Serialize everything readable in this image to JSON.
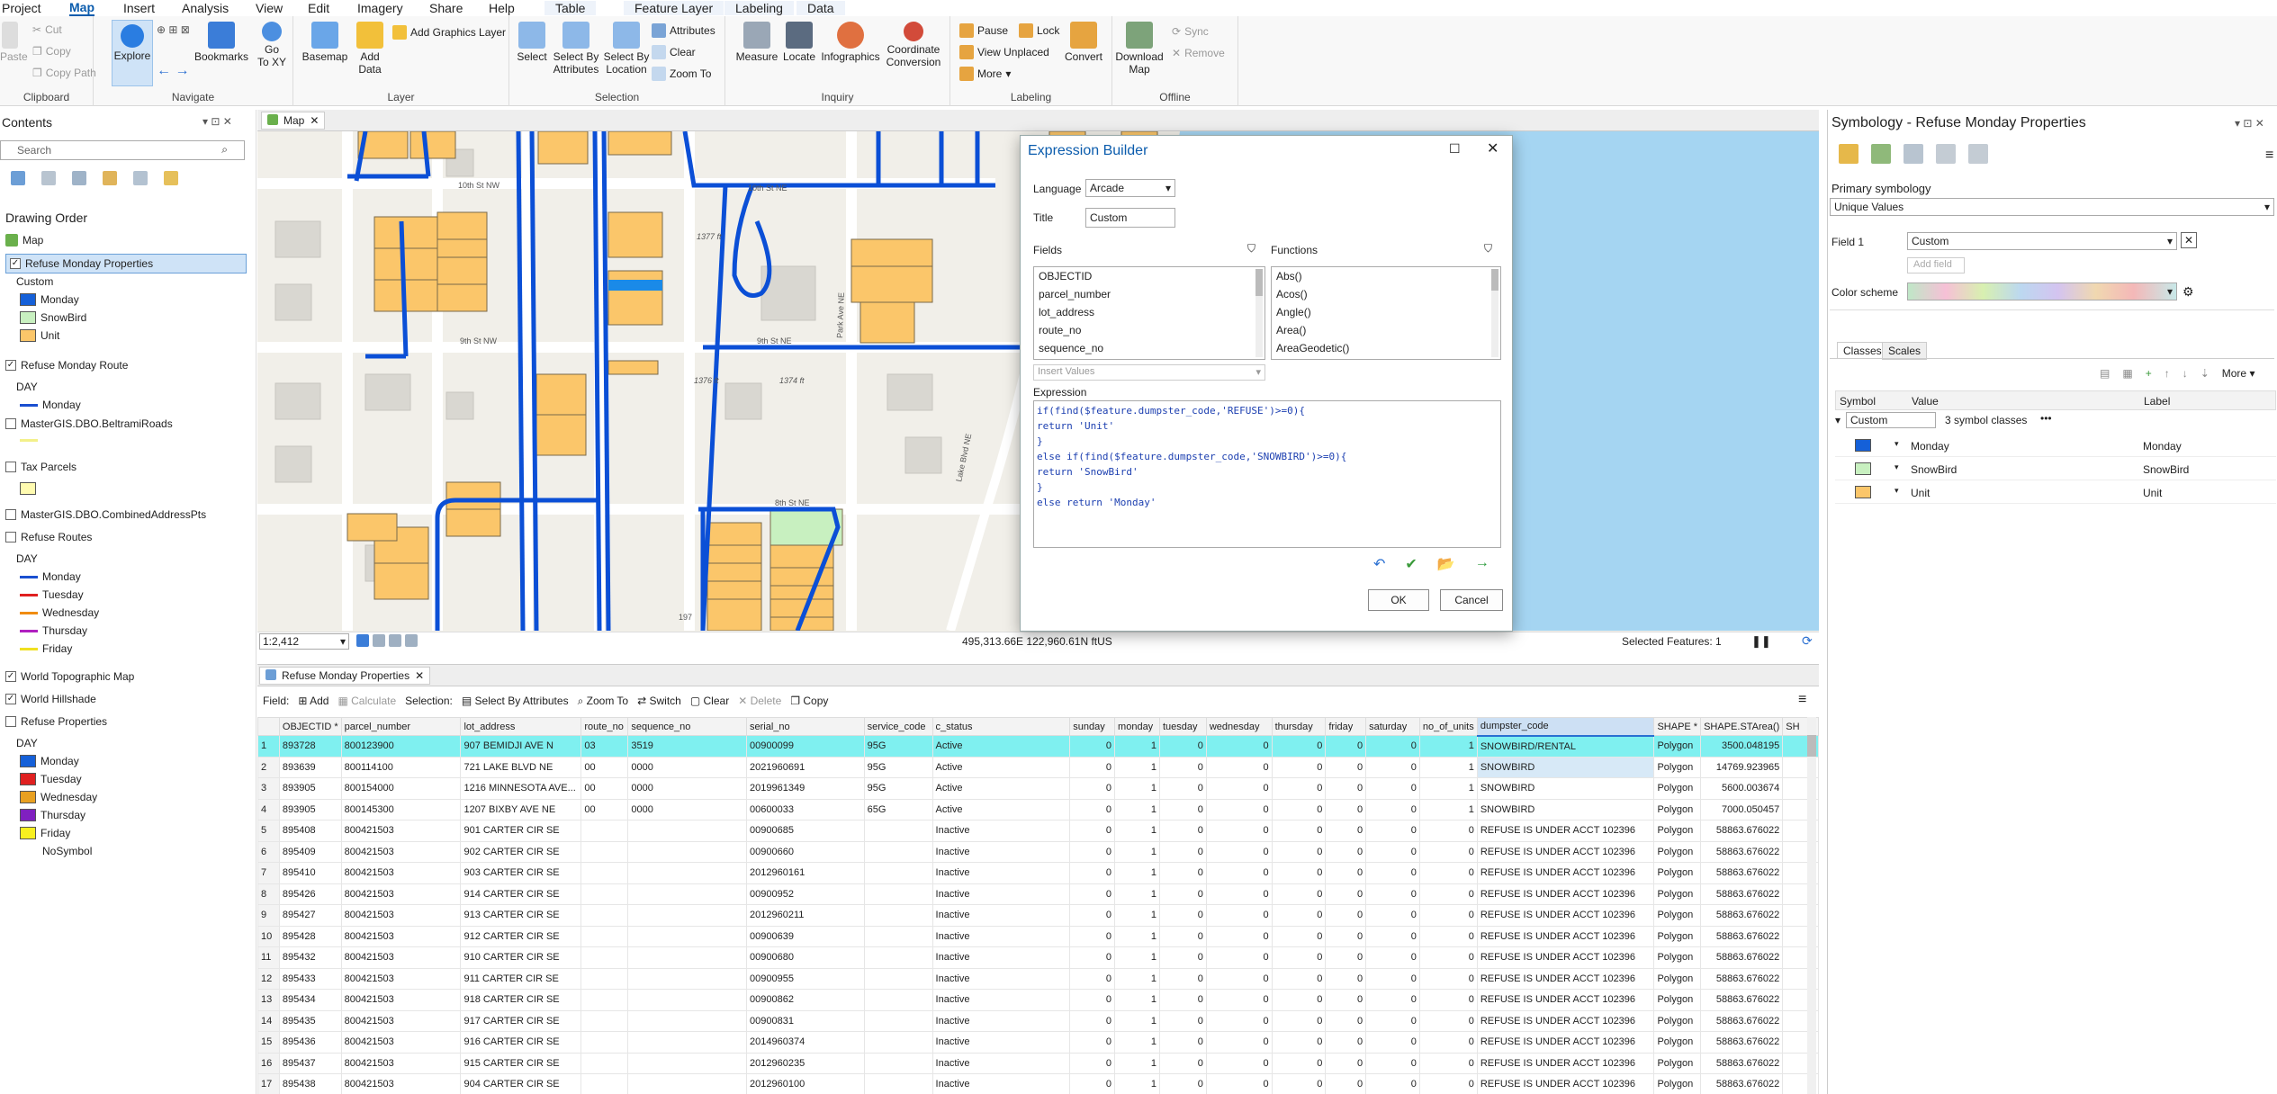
{
  "menu_tabs": [
    "Project",
    "Map",
    "Insert",
    "Analysis",
    "View",
    "Edit",
    "Imagery",
    "Share",
    "Help",
    "Table",
    "Feature Layer",
    "Labeling",
    "Data"
  ],
  "ribbon": {
    "clipboard": {
      "label": "Clipboard",
      "paste": "Paste",
      "cut": "Cut",
      "copy": "Copy",
      "copy_path": "Copy Path"
    },
    "navigate": {
      "label": "Navigate",
      "explore": "Explore",
      "bookmarks": "Bookmarks",
      "goto": "Go\nTo XY"
    },
    "layer": {
      "label": "Layer",
      "basemap": "Basemap",
      "add_data": "Add\nData",
      "add_graphics": "Add Graphics Layer"
    },
    "selection": {
      "label": "Selection",
      "select": "Select",
      "by_attr": "Select By\nAttributes",
      "by_loc": "Select By\nLocation",
      "attributes": "Attributes",
      "clear": "Clear",
      "zoom_to": "Zoom To"
    },
    "inquiry": {
      "label": "Inquiry",
      "measure": "Measure",
      "locate": "Locate",
      "infographics": "Infographics",
      "coord": "Coordinate\nConversion"
    },
    "labeling": {
      "label": "Labeling",
      "pause": "Pause",
      "lock": "Lock",
      "view_unplaced": "View Unplaced",
      "more": "More",
      "convert": "Convert"
    },
    "offline": {
      "label": "Offline",
      "download": "Download\nMap",
      "sync": "Sync",
      "remove": "Remove"
    }
  },
  "contents": {
    "title": "Contents",
    "search_placeholder": "Search",
    "drawing_order": "Drawing Order",
    "map": "Map",
    "layers": [
      {
        "name": "Refuse Monday Properties",
        "checked": true,
        "selected": true,
        "heading": "Custom",
        "legend": [
          {
            "label": "Monday",
            "color": "#1560d8",
            "kind": "swatch"
          },
          {
            "label": "SnowBird",
            "color": "#c8f0c0",
            "kind": "swatch"
          },
          {
            "label": "Unit",
            "color": "#fbc66a",
            "kind": "swatch"
          }
        ]
      },
      {
        "name": "Refuse Monday Route",
        "checked": true,
        "heading": "DAY",
        "legend": [
          {
            "label": "Monday",
            "color": "#1a4fd0",
            "kind": "line"
          }
        ]
      },
      {
        "name": "MasterGIS.DBO.BeltramiRoads",
        "checked": false,
        "heading": "",
        "legend": [
          {
            "label": "",
            "color": "#f3f08a",
            "kind": "line"
          }
        ]
      },
      {
        "name": "Tax Parcels",
        "checked": false,
        "heading": "",
        "legend": [
          {
            "label": "",
            "color": "#fffbb0",
            "kind": "swatch"
          }
        ]
      },
      {
        "name": "MasterGIS.DBO.CombinedAddressPts",
        "checked": false,
        "heading": "",
        "legend": []
      },
      {
        "name": "Refuse Routes",
        "checked": false,
        "heading": "DAY",
        "legend": [
          {
            "label": "Monday",
            "color": "#1a4fd0",
            "kind": "line"
          },
          {
            "label": "Tuesday",
            "color": "#e02020",
            "kind": "line"
          },
          {
            "label": "Wednesday",
            "color": "#f08c10",
            "kind": "line"
          },
          {
            "label": "Thursday",
            "color": "#b020c0",
            "kind": "line"
          },
          {
            "label": "Friday",
            "color": "#f0e020",
            "kind": "line"
          }
        ]
      },
      {
        "name": "World Topographic Map",
        "checked": true,
        "heading": "",
        "legend": []
      },
      {
        "name": "World Hillshade",
        "checked": true,
        "heading": "",
        "legend": []
      },
      {
        "name": "Refuse Properties",
        "checked": false,
        "heading": "DAY",
        "legend": [
          {
            "label": "Monday",
            "color": "#1560d8",
            "kind": "swatch"
          },
          {
            "label": "Tuesday",
            "color": "#e02020",
            "kind": "swatch"
          },
          {
            "label": "Wednesday",
            "color": "#e8a020",
            "kind": "swatch"
          },
          {
            "label": "Thursday",
            "color": "#8020c0",
            "kind": "swatch"
          },
          {
            "label": "Friday",
            "color": "#f8f020",
            "kind": "swatch"
          },
          {
            "label": "NoSymbol",
            "color": "",
            "kind": "none"
          }
        ]
      }
    ]
  },
  "map": {
    "tab": "Map",
    "scale": "1:2,412",
    "coords": "495,313.66E 122,960.61N ftUS",
    "selected_features": "Selected Features: 1",
    "labels": {
      "st10": "10th St NW",
      "st10b": "10th St NE",
      "st9": "9th St NW",
      "st9b": "9th St NE",
      "st8": "8th St NE",
      "h1": "1377 ft",
      "h2": "1376 ft",
      "h3": "1374 ft",
      "lake": "Lake Blvd NE",
      "park": "Park Ave NE",
      "hwy": "197"
    }
  },
  "dialog": {
    "title": "Expression Builder",
    "language_label": "Language",
    "language": "Arcade",
    "title_label": "Title",
    "title_value": "Custom",
    "fields_label": "Fields",
    "functions_label": "Functions",
    "fields": [
      "OBJECTID",
      "parcel_number",
      "lot_address",
      "route_no",
      "sequence_no"
    ],
    "functions": [
      "Abs()",
      "Acos()",
      "Angle()",
      "Area()",
      "AreaGeodetic()"
    ],
    "insert_values": "Insert Values",
    "expression_label": "Expression",
    "expression_lines": [
      "if(find($feature.dumpster_code,'REFUSE')>=0){",
      "return 'Unit'",
      "}",
      "else if(find($feature.dumpster_code,'SNOWBIRD')>=0){",
      "return 'SnowBird'",
      "}",
      "else return 'Monday'"
    ],
    "ok": "OK",
    "cancel": "Cancel"
  },
  "symbology": {
    "title": "Symbology - Refuse Monday Properties",
    "primary": "Primary symbology",
    "method": "Unique Values",
    "field1_label": "Field 1",
    "field1": "Custom",
    "add_field": "Add field",
    "color_scheme": "Color scheme",
    "tabs": [
      "Classes",
      "Scales"
    ],
    "more": "More",
    "col_symbol": "Symbol",
    "col_value": "Value",
    "col_label": "Label",
    "group": "Custom",
    "group_count": "3 symbol classes",
    "classes": [
      {
        "value": "Monday",
        "label": "Monday",
        "color": "#1560d8"
      },
      {
        "value": "SnowBird",
        "label": "SnowBird",
        "color": "#c8f0c0"
      },
      {
        "value": "Unit",
        "label": "Unit",
        "color": "#fbc66a"
      }
    ]
  },
  "table": {
    "tab": "Refuse Monday Properties",
    "toolbar": {
      "field": "Field:",
      "add": "Add",
      "calculate": "Calculate",
      "selection": "Selection:",
      "select_by_attr": "Select By Attributes",
      "zoom_to": "Zoom To",
      "switch": "Switch",
      "clear": "Clear",
      "delete": "Delete",
      "copy": "Copy"
    },
    "columns": [
      "",
      "OBJECTID *",
      "parcel_number",
      "lot_address",
      "route_no",
      "sequence_no",
      "serial_no",
      "service_code",
      "c_status",
      "sunday",
      "monday",
      "tuesday",
      "wednesday",
      "thursday",
      "friday",
      "saturday",
      "no_of_units",
      "dumpster_code",
      "SHAPE *",
      "SHAPE.STArea()",
      "SH"
    ],
    "rows": [
      [
        "1",
        "893728",
        "800123900",
        "907 BEMIDJI AVE N",
        "03",
        "3519",
        "00900099",
        "95G",
        "Active",
        "0",
        "1",
        "0",
        "0",
        "0",
        "0",
        "0",
        "1",
        "SNOWBIRD/RENTAL",
        "Polygon",
        "3500.048195"
      ],
      [
        "2",
        "893639",
        "800114100",
        "721 LAKE BLVD NE",
        "00",
        "0000",
        "2021960691",
        "95G",
        "Active",
        "0",
        "1",
        "0",
        "0",
        "0",
        "0",
        "0",
        "1",
        "SNOWBIRD",
        "Polygon",
        "14769.923965"
      ],
      [
        "3",
        "893905",
        "800154000",
        "1216 MINNESOTA AVE...",
        "00",
        "0000",
        "2019961349",
        "95G",
        "Active",
        "0",
        "1",
        "0",
        "0",
        "0",
        "0",
        "0",
        "1",
        "SNOWBIRD",
        "Polygon",
        "5600.003674"
      ],
      [
        "4",
        "893905",
        "800145300",
        "1207 BIXBY AVE NE",
        "00",
        "0000",
        "00600033",
        "65G",
        "Active",
        "0",
        "1",
        "0",
        "0",
        "0",
        "0",
        "0",
        "1",
        "SNOWBIRD",
        "Polygon",
        "7000.050457"
      ],
      [
        "5",
        "895408",
        "800421503",
        "901 CARTER CIR SE",
        "",
        "",
        "00900685",
        "",
        "Inactive",
        "0",
        "1",
        "0",
        "0",
        "0",
        "0",
        "0",
        "0",
        "REFUSE IS UNDER ACCT 102396",
        "Polygon",
        "58863.676022"
      ],
      [
        "6",
        "895409",
        "800421503",
        "902 CARTER CIR SE",
        "",
        "",
        "00900660",
        "",
        "Inactive",
        "0",
        "1",
        "0",
        "0",
        "0",
        "0",
        "0",
        "0",
        "REFUSE IS UNDER ACCT 102396",
        "Polygon",
        "58863.676022"
      ],
      [
        "7",
        "895410",
        "800421503",
        "903 CARTER CIR SE",
        "",
        "",
        "2012960161",
        "",
        "Inactive",
        "0",
        "1",
        "0",
        "0",
        "0",
        "0",
        "0",
        "0",
        "REFUSE IS UNDER ACCT 102396",
        "Polygon",
        "58863.676022"
      ],
      [
        "8",
        "895426",
        "800421503",
        "914 CARTER CIR SE",
        "",
        "",
        "00900952",
        "",
        "Inactive",
        "0",
        "1",
        "0",
        "0",
        "0",
        "0",
        "0",
        "0",
        "REFUSE IS UNDER ACCT 102396",
        "Polygon",
        "58863.676022"
      ],
      [
        "9",
        "895427",
        "800421503",
        "913 CARTER CIR SE",
        "",
        "",
        "2012960211",
        "",
        "Inactive",
        "0",
        "1",
        "0",
        "0",
        "0",
        "0",
        "0",
        "0",
        "REFUSE IS UNDER ACCT 102396",
        "Polygon",
        "58863.676022"
      ],
      [
        "10",
        "895428",
        "800421503",
        "912 CARTER CIR SE",
        "",
        "",
        "00900639",
        "",
        "Inactive",
        "0",
        "1",
        "0",
        "0",
        "0",
        "0",
        "0",
        "0",
        "REFUSE IS UNDER ACCT 102396",
        "Polygon",
        "58863.676022"
      ],
      [
        "11",
        "895432",
        "800421503",
        "910 CARTER CIR SE",
        "",
        "",
        "00900680",
        "",
        "Inactive",
        "0",
        "1",
        "0",
        "0",
        "0",
        "0",
        "0",
        "0",
        "REFUSE IS UNDER ACCT 102396",
        "Polygon",
        "58863.676022"
      ],
      [
        "12",
        "895433",
        "800421503",
        "911 CARTER CIR SE",
        "",
        "",
        "00900955",
        "",
        "Inactive",
        "0",
        "1",
        "0",
        "0",
        "0",
        "0",
        "0",
        "0",
        "REFUSE IS UNDER ACCT 102396",
        "Polygon",
        "58863.676022"
      ],
      [
        "13",
        "895434",
        "800421503",
        "918 CARTER CIR SE",
        "",
        "",
        "00900862",
        "",
        "Inactive",
        "0",
        "1",
        "0",
        "0",
        "0",
        "0",
        "0",
        "0",
        "REFUSE IS UNDER ACCT 102396",
        "Polygon",
        "58863.676022"
      ],
      [
        "14",
        "895435",
        "800421503",
        "917 CARTER CIR SE",
        "",
        "",
        "00900831",
        "",
        "Inactive",
        "0",
        "1",
        "0",
        "0",
        "0",
        "0",
        "0",
        "0",
        "REFUSE IS UNDER ACCT 102396",
        "Polygon",
        "58863.676022"
      ],
      [
        "15",
        "895436",
        "800421503",
        "916 CARTER CIR SE",
        "",
        "",
        "2014960374",
        "",
        "Inactive",
        "0",
        "1",
        "0",
        "0",
        "0",
        "0",
        "0",
        "0",
        "REFUSE IS UNDER ACCT 102396",
        "Polygon",
        "58863.676022"
      ],
      [
        "16",
        "895437",
        "800421503",
        "915 CARTER CIR SE",
        "",
        "",
        "2012960235",
        "",
        "Inactive",
        "0",
        "1",
        "0",
        "0",
        "0",
        "0",
        "0",
        "0",
        "REFUSE IS UNDER ACCT 102396",
        "Polygon",
        "58863.676022"
      ],
      [
        "17",
        "895438",
        "800421503",
        "904 CARTER CIR SE",
        "",
        "",
        "2012960100",
        "",
        "Inactive",
        "0",
        "1",
        "0",
        "0",
        "0",
        "0",
        "0",
        "0",
        "REFUSE IS UNDER ACCT 102396",
        "Polygon",
        "58863.676022"
      ]
    ]
  }
}
